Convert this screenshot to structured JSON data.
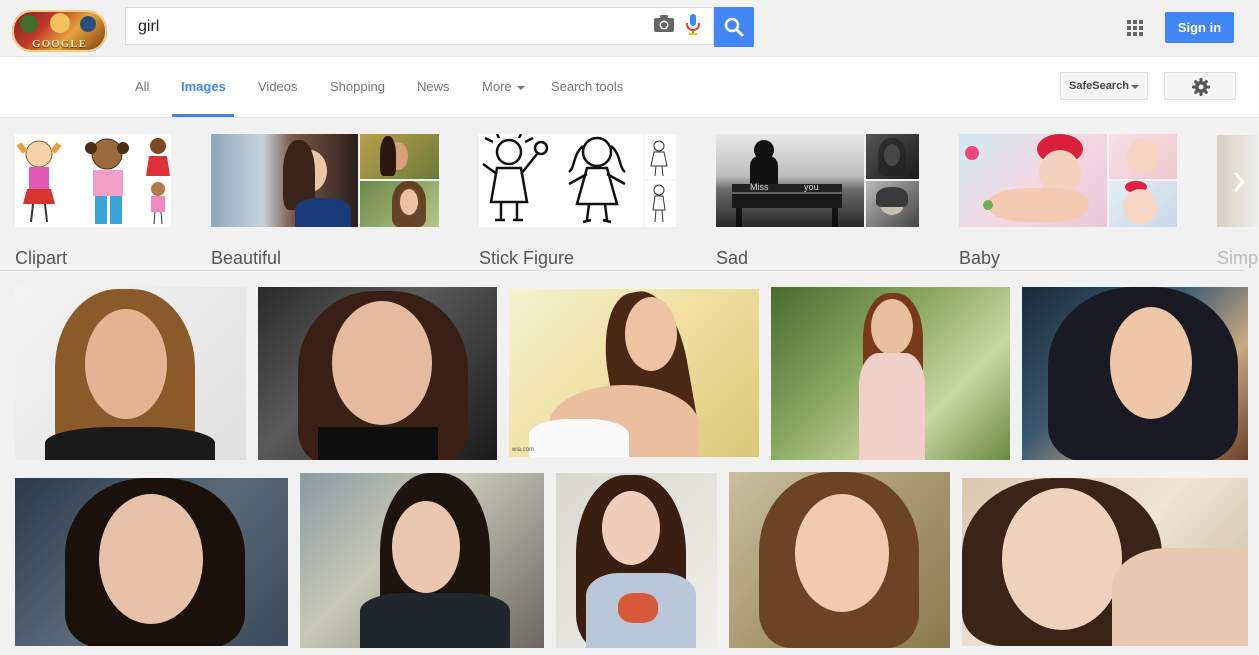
{
  "search": {
    "query": "girl"
  },
  "header": {
    "logo_text": "GOOGLE",
    "signin_label": "Sign in"
  },
  "tabs": [
    {
      "label": "All"
    },
    {
      "label": "Images"
    },
    {
      "label": "Videos"
    },
    {
      "label": "Shopping"
    },
    {
      "label": "News"
    },
    {
      "label": "More"
    },
    {
      "label": "Search tools"
    }
  ],
  "controls": {
    "safesearch_label": "SafeSearch"
  },
  "related": [
    {
      "label": "Clipart"
    },
    {
      "label": "Beautiful"
    },
    {
      "label": "Stick Figure"
    },
    {
      "label": "Sad"
    },
    {
      "label": "Baby"
    },
    {
      "label": "Simp"
    }
  ],
  "sad_overlay": {
    "left": "Miss",
    "right": "you"
  },
  "watermark": "wia.com",
  "colors": {
    "accent": "#4285f4",
    "page_bg": "#f1f1f1"
  }
}
